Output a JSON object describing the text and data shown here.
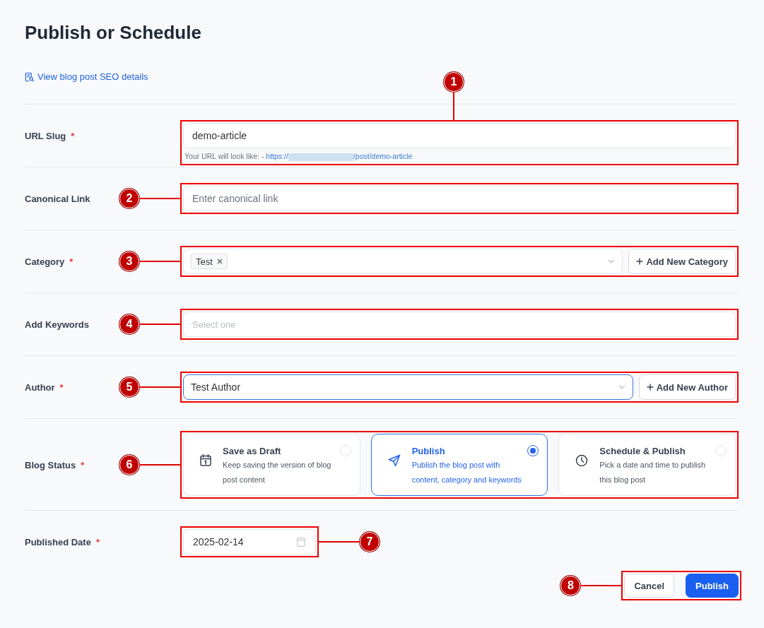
{
  "page": {
    "title": "Publish or Schedule"
  },
  "seo_link": {
    "label": "View blog post SEO details"
  },
  "fields": [
    {
      "kind": "text",
      "label": "URL Slug",
      "required_mark": "*",
      "value": "demo-article",
      "url_preview": {
        "label": "Your URL will look like: -",
        "prefix": "https://",
        "suffix": "/post/demo-article"
      },
      "callout": {
        "number": "1",
        "kind": "top"
      }
    },
    {
      "kind": "text",
      "label": "Canonical Link",
      "placeholder": "Enter canonical link",
      "callout": {
        "number": "2",
        "kind": "left"
      }
    },
    {
      "kind": "tags",
      "label": "Category",
      "required_mark": "*",
      "tags": [
        {
          "label": "Test"
        }
      ],
      "add_button": "Add New Category",
      "callout": {
        "number": "3",
        "kind": "left"
      }
    },
    {
      "kind": "search",
      "label": "Add Keywords",
      "placeholder": "Select one",
      "callout": {
        "number": "4",
        "kind": "left"
      }
    },
    {
      "kind": "select",
      "label": "Author",
      "required_mark": "*",
      "value": "Test Author",
      "focused": true,
      "add_button": "Add New Author",
      "callout": {
        "number": "5",
        "kind": "left"
      }
    },
    {
      "kind": "options",
      "label": "Blog Status",
      "required_mark": "*",
      "options": [
        {
          "title": "Save as Draft",
          "description": "Keep saving the version of blog post content",
          "selected": false
        },
        {
          "title": "Publish",
          "description": "Publish the blog post with content, category and keywords",
          "selected": true
        },
        {
          "title": "Schedule & Publish",
          "description": "Pick a date and time to publish this blog post",
          "selected": false
        }
      ],
      "callout": {
        "number": "6",
        "kind": "left"
      }
    },
    {
      "kind": "date",
      "label": "Published Date",
      "required_mark": "*",
      "value": "2025-02-14",
      "callout": {
        "number": "7",
        "kind": "right"
      }
    }
  ],
  "actions": {
    "buttons": [
      {
        "kind": "secondary",
        "label": "Cancel"
      },
      {
        "kind": "primary",
        "label": "Publish"
      }
    ],
    "callout": {
      "number": "8",
      "kind": "left"
    }
  }
}
